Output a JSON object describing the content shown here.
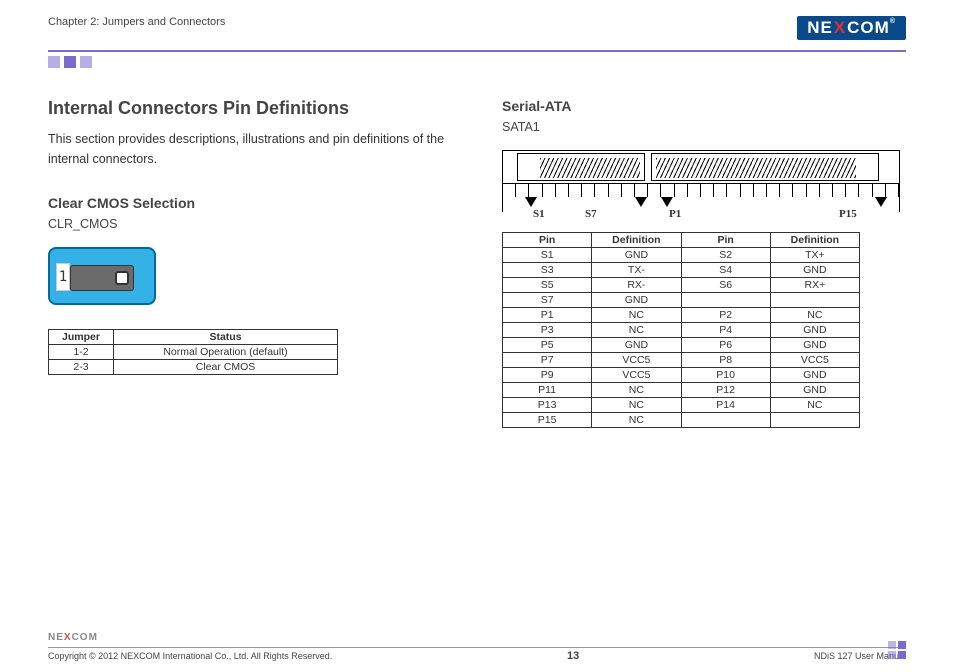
{
  "chapter": "Chapter 2: Jumpers and Connectors",
  "brand": {
    "pre": "NE",
    "x": "X",
    "post": "COM",
    "reg": "®"
  },
  "title": "Internal Connectors Pin Definitions",
  "intro": "This section provides descriptions, illustrations and pin definitions of the internal connectors.",
  "cmos": {
    "heading": "Clear CMOS Selection",
    "label": "CLR_CMOS",
    "pin1": "1",
    "table_h": [
      "Jumper",
      "Status"
    ],
    "rows": [
      [
        "1-2",
        "Normal Operation (default)"
      ],
      [
        "2-3",
        "Clear CMOS"
      ]
    ]
  },
  "sata": {
    "heading": "Serial-ATA",
    "label": "SATA1",
    "pins": {
      "s1": "S1",
      "s7": "S7",
      "p1": "P1",
      "p15": "P15"
    },
    "table_h": [
      "Pin",
      "Definition",
      "Pin",
      "Definition"
    ],
    "rows": [
      [
        "S1",
        "GND",
        "S2",
        "TX+"
      ],
      [
        "S3",
        "TX-",
        "S4",
        "GND"
      ],
      [
        "S5",
        "RX-",
        "S6",
        "RX+"
      ],
      [
        "S7",
        "GND",
        "",
        ""
      ],
      [
        "P1",
        "NC",
        "P2",
        "NC"
      ],
      [
        "P3",
        "NC",
        "P4",
        "GND"
      ],
      [
        "P5",
        "GND",
        "P6",
        "GND"
      ],
      [
        "P7",
        "VCC5",
        "P8",
        "VCC5"
      ],
      [
        "P9",
        "VCC5",
        "P10",
        "GND"
      ],
      [
        "P11",
        "NC",
        "P12",
        "GND"
      ],
      [
        "P13",
        "NC",
        "P14",
        "NC"
      ],
      [
        "P15",
        "NC",
        "",
        ""
      ]
    ]
  },
  "footer": {
    "copyright": "Copyright © 2012 NEXCOM International Co., Ltd. All Rights Reserved.",
    "page": "13",
    "doc": "NDiS 127 User Manual"
  }
}
